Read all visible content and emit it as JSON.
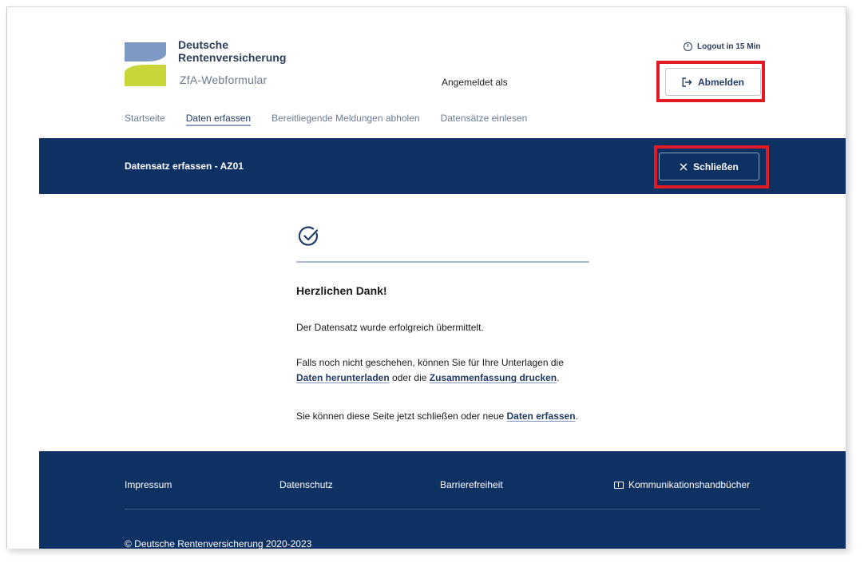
{
  "header": {
    "brand_line1": "Deutsche",
    "brand_line2": "Rentenversicherung",
    "brand_line3": "ZfA-Webformular",
    "logged_in_as": "Angemeldet als",
    "logout_timer": "Logout in 15 Min",
    "logout_button": "Abmelden"
  },
  "nav": {
    "items": [
      "Startseite",
      "Daten erfassen",
      "Bereitliegende Meldungen abholen",
      "Datensätze einlesen"
    ],
    "active_index": 1
  },
  "titlebar": {
    "title": "Datensatz erfassen - AZ01",
    "close_button": "Schließen"
  },
  "content": {
    "heading": "Herzlichen Dank!",
    "message": "Der Datensatz wurde erfolgreich übermittelt.",
    "hint_line1": "Falls noch nicht geschehen, können Sie für Ihre Unterlagen die",
    "download_link": "Daten herunterladen",
    "or_text": "oder die",
    "print_link": "Zusammenfassung drucken",
    "period1": ".",
    "close_text": "Sie können diese Seite jetzt schließen oder neue",
    "capture_link": "Daten erfassen",
    "period2": "."
  },
  "footer": {
    "impressum": "Impressum",
    "datenschutz": "Datenschutz",
    "barrierefreiheit": "Barrierefreiheit",
    "handbuecher": "Kommunikationshandbücher",
    "copyright": "© Deutsche Rentenversicherung 2020-2023"
  },
  "colors": {
    "navy": "#0e3164",
    "highlight": "#e01b24",
    "logo_blue": "#7e9ac4",
    "logo_green": "#c8d63a"
  },
  "icons": [
    "clock-icon",
    "logout-icon",
    "close-icon",
    "check-circle-icon",
    "book-icon"
  ]
}
